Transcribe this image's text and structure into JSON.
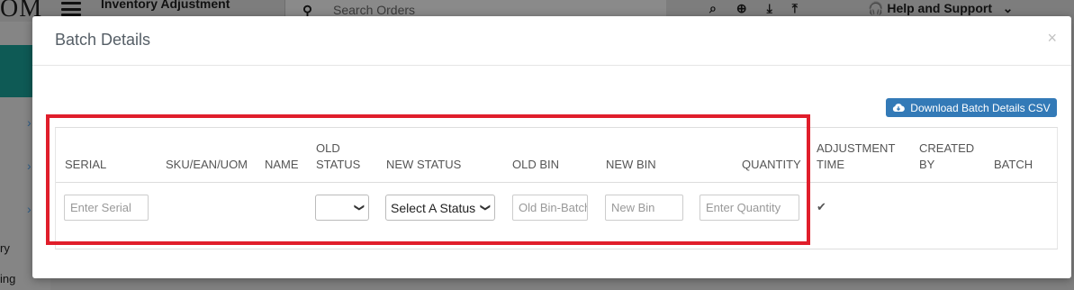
{
  "background": {
    "logo": "OM",
    "title": "Inventory Adjustment",
    "search_placeholder": "Search Orders",
    "help": "Help and Support",
    "side_text_1": "ry",
    "side_text_2": "ing"
  },
  "modal": {
    "title": "Batch Details",
    "close": "×",
    "download_button": "Download Batch Details CSV"
  },
  "table": {
    "headers": {
      "serial": "SERIAL",
      "sku": "SKU/EAN/UOM",
      "name": "NAME",
      "old_status_1": "OLD",
      "old_status_2": "STATUS",
      "new_status": "NEW STATUS",
      "old_bin": "OLD BIN",
      "new_bin": "NEW BIN",
      "quantity": "QUANTITY",
      "adjustment_time_1": "ADJUSTMENT",
      "adjustment_time_2": "TIME",
      "created_by_1": "CREATED",
      "created_by_2": "BY",
      "batch": "BATCH"
    },
    "row": {
      "serial_placeholder": "Enter Serial",
      "old_status_value": "",
      "new_status_value": "Select A Status",
      "old_bin_placeholder": "Old Bin-Batch",
      "new_bin_placeholder": "New Bin",
      "quantity_placeholder": "Enter Quantity",
      "adjustment_check": "✔"
    }
  },
  "colors": {
    "primary_button": "#337ab7",
    "highlight": "#e01e2b"
  }
}
